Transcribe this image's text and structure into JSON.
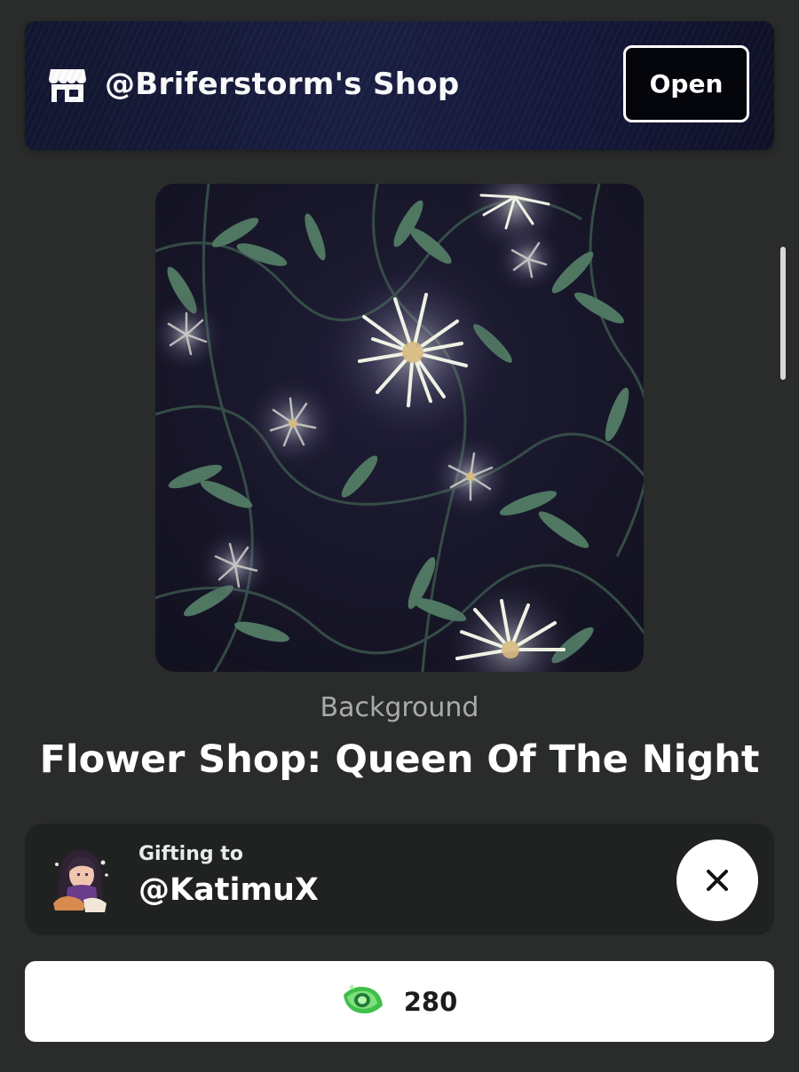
{
  "shop": {
    "title": "@Briferstorm's Shop",
    "open_label": "Open",
    "icon": "storefront-icon"
  },
  "item": {
    "category": "Background",
    "name": "Flower Shop: Queen Of The Night",
    "image": "night-flower-pattern"
  },
  "gift": {
    "label": "Gifting to",
    "recipient": "@KatimuX",
    "close_icon": "close-icon"
  },
  "purchase": {
    "price": "280",
    "currency_icon": "gem-currency-icon"
  },
  "colors": {
    "background": "#2a2c2b",
    "banner": "#15183a",
    "panel": "#1f2221",
    "button": "#ffffff",
    "currency": "#3fbf4a"
  }
}
